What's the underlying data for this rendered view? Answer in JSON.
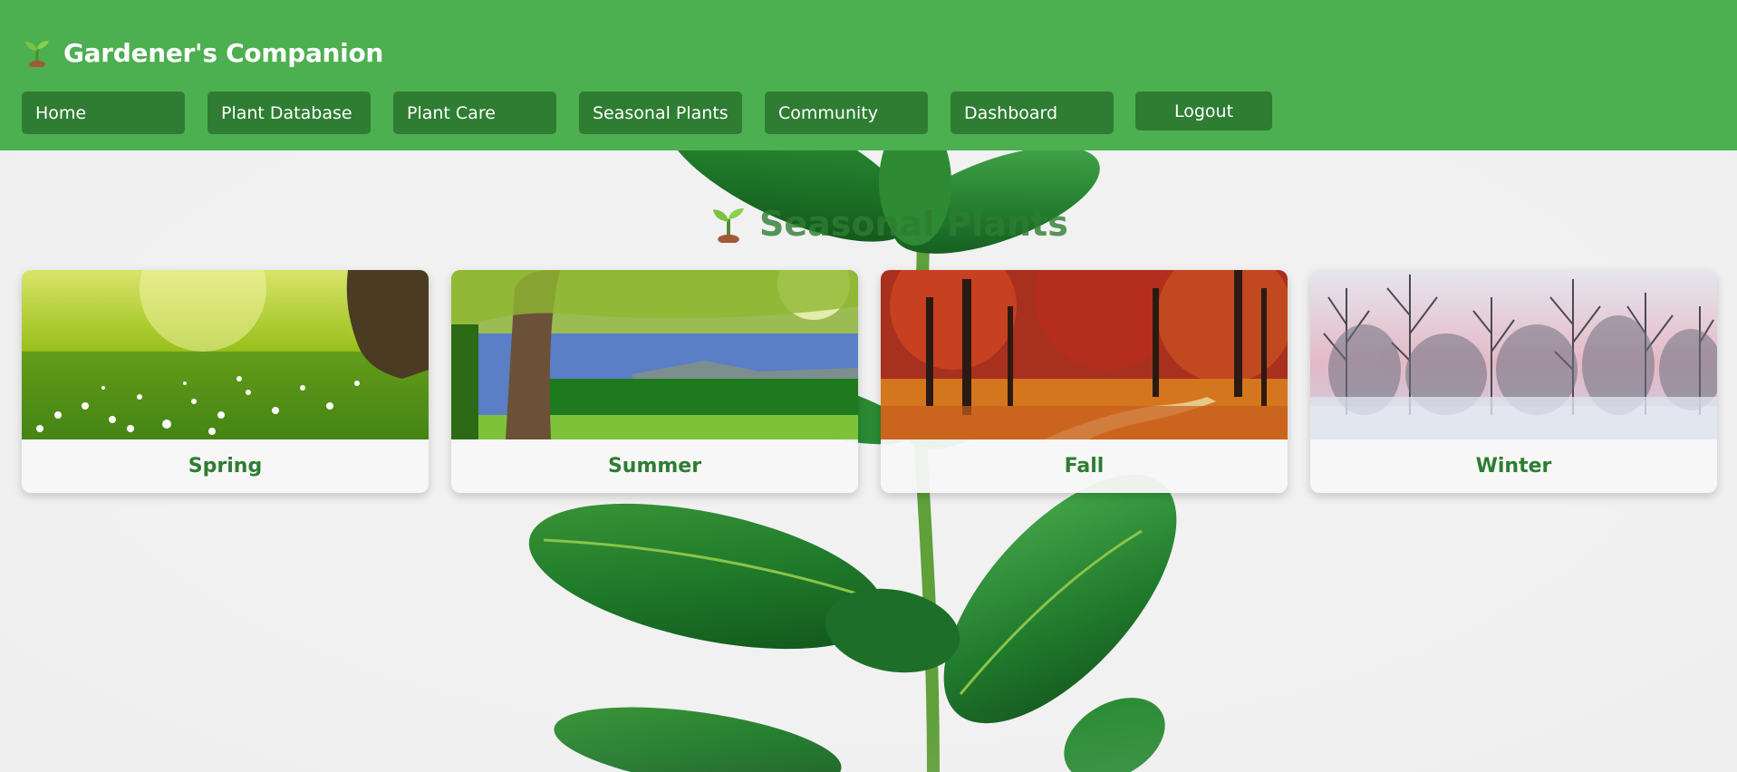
{
  "header": {
    "brand_icon": "sprout-icon",
    "title": "Gardener's Companion",
    "nav": [
      {
        "label": "Home"
      },
      {
        "label": "Plant Database"
      },
      {
        "label": "Plant Care"
      },
      {
        "label": "Seasonal Plants"
      },
      {
        "label": "Community"
      },
      {
        "label": "Dashboard"
      }
    ],
    "logout_label": "Logout"
  },
  "main": {
    "title_icon": "sprout-icon",
    "title": "Seasonal Plants",
    "seasons": [
      {
        "label": "Spring",
        "image": "spring-meadow-image"
      },
      {
        "label": "Summer",
        "image": "summer-tree-image"
      },
      {
        "label": "Fall",
        "image": "fall-forest-image"
      },
      {
        "label": "Winter",
        "image": "winter-trees-image"
      }
    ]
  },
  "colors": {
    "header_bg": "#4caf50",
    "nav_button_bg": "#2e7d32",
    "accent_text": "#2e7d32",
    "page_bg": "#f0f0f0"
  }
}
